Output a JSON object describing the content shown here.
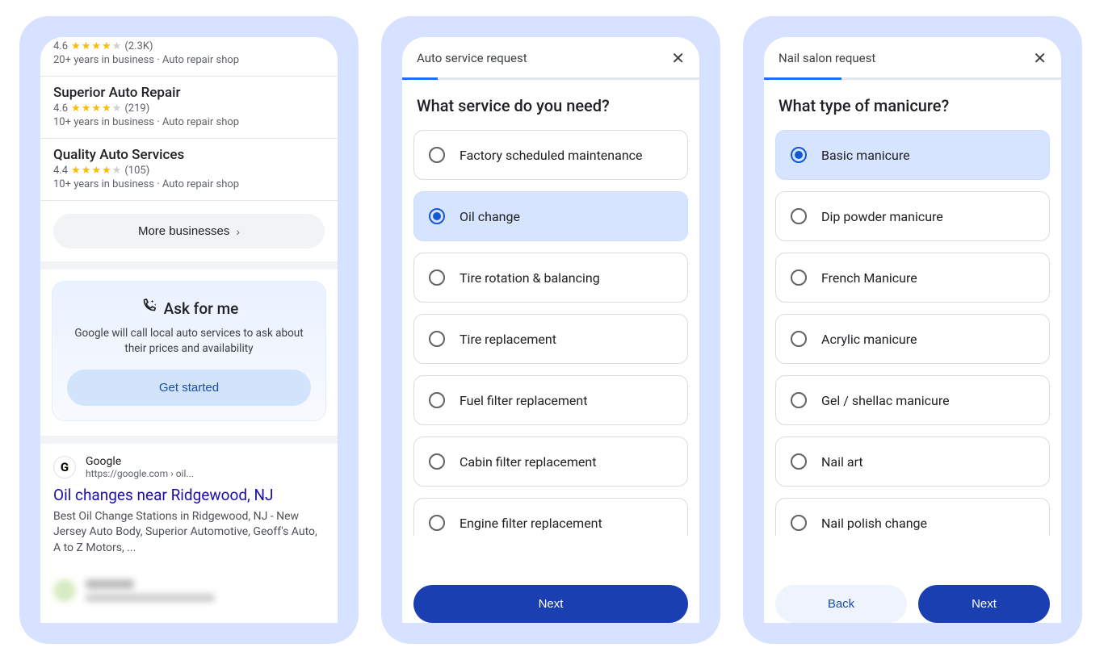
{
  "phone1": {
    "listings": [
      {
        "name": "",
        "rating": "4.6",
        "reviews": "(2.3K)",
        "years": "20+ years in business",
        "category": "Auto repair shop",
        "stars_full": 4,
        "stars_half": 0,
        "stars_empty": 1
      },
      {
        "name": "Superior Auto Repair",
        "rating": "4.6",
        "reviews": "(219)",
        "years": "10+ years in business",
        "category": "Auto repair shop",
        "stars_full": 4,
        "stars_half": 0,
        "stars_empty": 1
      },
      {
        "name": "Quality Auto Services",
        "rating": "4.4",
        "reviews": "(105)",
        "years": "10+ years in business",
        "category": "Auto repair shop",
        "stars_full": 4,
        "stars_half": 0,
        "stars_empty": 1
      }
    ],
    "more_businesses": "More businesses",
    "ask": {
      "title": "Ask for me",
      "desc": "Google will call local auto services to ask about their prices and availability",
      "cta": "Get started"
    },
    "result": {
      "source_name": "Google",
      "source_url": "https://google.com › oil...",
      "title": "Oil changes near Ridgewood, NJ",
      "snippet": "Best Oil Change Stations in Ridgewood, NJ - New Jersey Auto Body, Superior Automotive, Geoff's Auto, A to Z Motors, ..."
    }
  },
  "phone2": {
    "header": "Auto service request",
    "progress_pct": 12,
    "question": "What service do you need?",
    "options": [
      {
        "label": "Factory scheduled maintenance",
        "selected": false
      },
      {
        "label": "Oil change",
        "selected": true
      },
      {
        "label": "Tire rotation & balancing",
        "selected": false
      },
      {
        "label": "Tire replacement",
        "selected": false
      },
      {
        "label": "Fuel filter replacement",
        "selected": false
      },
      {
        "label": "Cabin filter replacement",
        "selected": false
      },
      {
        "label": "Engine filter replacement",
        "selected": false
      }
    ],
    "next": "Next"
  },
  "phone3": {
    "header": "Nail salon request",
    "progress_pct": 26,
    "question": "What type of manicure?",
    "options": [
      {
        "label": "Basic manicure",
        "selected": true
      },
      {
        "label": "Dip powder manicure",
        "selected": false
      },
      {
        "label": "French Manicure",
        "selected": false
      },
      {
        "label": "Acrylic manicure",
        "selected": false
      },
      {
        "label": "Gel / shellac manicure",
        "selected": false
      },
      {
        "label": "Nail art",
        "selected": false
      },
      {
        "label": "Nail polish change",
        "selected": false
      }
    ],
    "back": "Back",
    "next": "Next"
  }
}
